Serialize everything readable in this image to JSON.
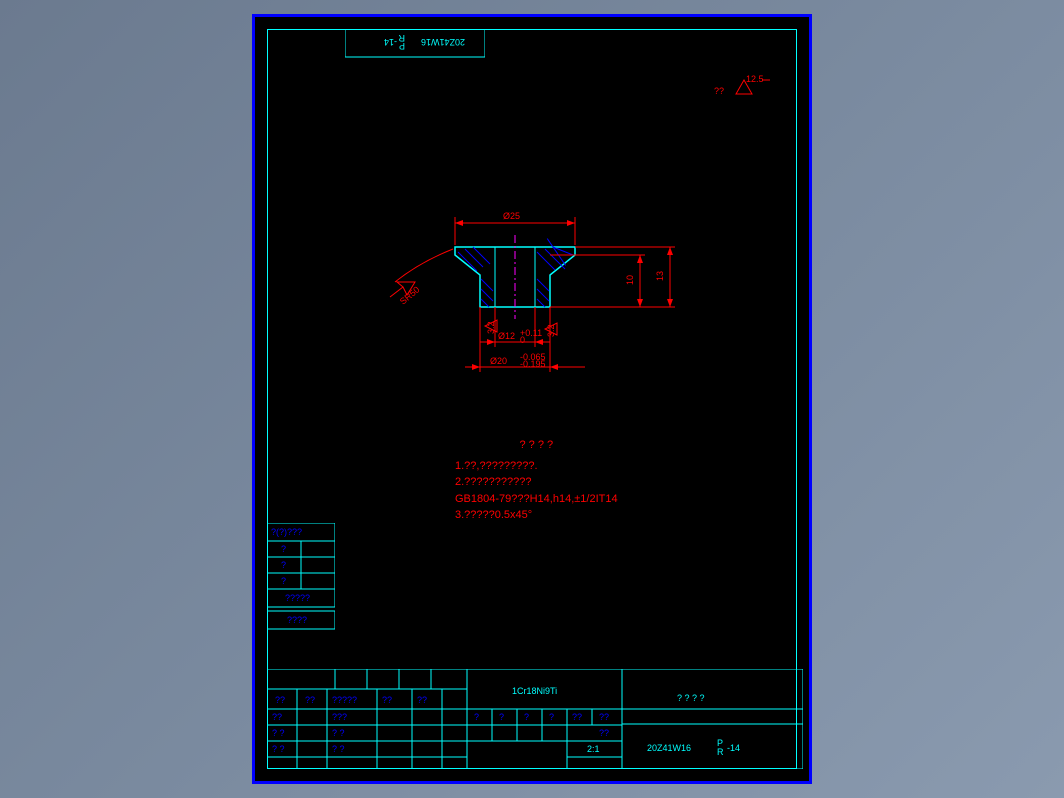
{
  "drawing_number_top": "20Z41W16",
  "drawing_number_top_suffix": "P",
  "drawing_number_top_suffix2": "R",
  "drawing_number_top_rev": " -14",
  "surface_finish_callout": "12.5",
  "surface_finish_prefix": "??",
  "dimensions": {
    "d25": "Ø25",
    "d12": "Ø12",
    "d12_tol": "+0.11",
    "d12_tol2": "0",
    "d20": "Ø20",
    "d20_tol1": "-0.065",
    "d20_tol2": "-0.195",
    "h10": "10",
    "h13": "13",
    "sr50": "SR50",
    "sf32a": "3.2",
    "sf32b": "3.2"
  },
  "tech_notes": {
    "title": "?  ?  ?  ?",
    "line1": "1.??,?????????.",
    "line2": "2.???????????",
    "line3": "GB1804-79???H14,h14,±1/2IT14",
    "line4": "3.?????0.5x45°"
  },
  "revision_block": {
    "header": "?(?)???",
    "r1": "?",
    "r2": "?",
    "r3": "?",
    "r4": "?????",
    "r5": "????"
  },
  "title_block": {
    "material": "1Cr18Ni9Ti",
    "company": "?  ?  ?  ?",
    "scale": "2:1",
    "drawing_no": "20Z41W16",
    "drawing_no_suffix": "P",
    "drawing_no_suffix2": "R",
    "drawing_no_rev": " -14",
    "col_h1": "??",
    "col_h2": "??",
    "col_h3": "?????",
    "col_h4": "??",
    "col_h5": "??",
    "row1_a": "??",
    "row1_b": "???",
    "row2_a": "? ?",
    "row2_b": "? ?",
    "row3_a": "? ?",
    "row3_b": "? ?",
    "bot_h1": "?",
    "bot_h2": "?",
    "bot_h3": "?",
    "bot_h4": "?",
    "bot_h5": "??",
    "bot_h6": "??",
    "bot_h7": "??"
  }
}
